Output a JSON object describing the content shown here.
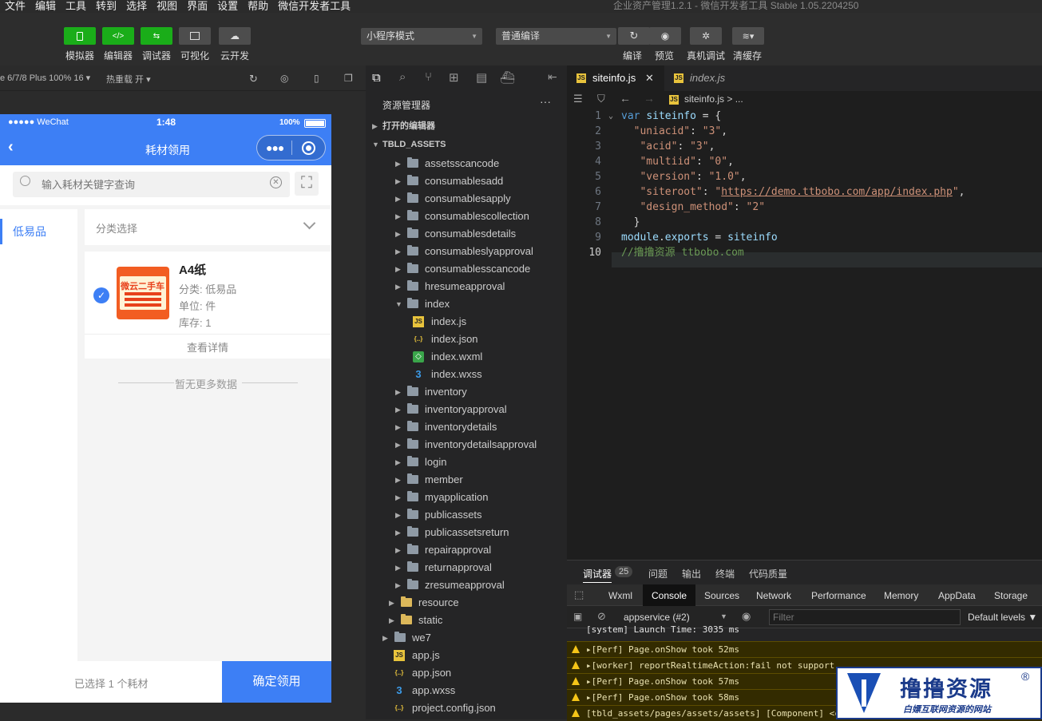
{
  "menu": [
    "文件",
    "编辑",
    "工具",
    "转到",
    "选择",
    "视图",
    "界面",
    "设置",
    "帮助",
    "微信开发者工具"
  ],
  "window_title": "企业资产管理1.2.1 - 微信开发者工具 Stable 1.05.2204250",
  "toolbar": {
    "simulator": "模拟器",
    "editor": "编辑器",
    "debugger": "调试器",
    "visual": "可视化",
    "cloud": "云开发",
    "mode": "小程序模式",
    "compile_mode": "普通编译",
    "compile": "编译",
    "preview": "预览",
    "real_debug": "真机调试",
    "clear_cache": "清缓存"
  },
  "simbar": {
    "device": "e 6/7/8 Plus 100% 16 ▾",
    "hot_reload": "热重载 开 ▾"
  },
  "phone": {
    "carrier": "●●●●● WeChat",
    "time": "1:48",
    "battery": "100%",
    "nav_title": "耗材领用",
    "search_placeholder": "输入耗材关键字查询",
    "left_category": "低易品",
    "category_select": "分类选择",
    "item": {
      "name": "A4纸",
      "category": "分类:  低易品",
      "unit": "单位:  件",
      "stock": "库存:  1",
      "detail": "查看详情",
      "thumb_text": "微云二手车"
    },
    "no_more": "暂无更多数据",
    "selected_text": "已选择 1 个耗材",
    "confirm": "确定领用"
  },
  "explorer": {
    "title": "资源管理器",
    "open_editors": "打开的编辑器",
    "root": "TBLD_ASSETS",
    "items": [
      {
        "label": "assetsscancode",
        "kind": "folder",
        "depth": 2
      },
      {
        "label": "consumablesadd",
        "kind": "folder",
        "depth": 2
      },
      {
        "label": "consumablesapply",
        "kind": "folder",
        "depth": 2
      },
      {
        "label": "consumablescollection",
        "kind": "folder",
        "depth": 2
      },
      {
        "label": "consumablesdetails",
        "kind": "folder",
        "depth": 2
      },
      {
        "label": "consumableslyapproval",
        "kind": "folder",
        "depth": 2
      },
      {
        "label": "consumablesscancode",
        "kind": "folder",
        "depth": 2
      },
      {
        "label": "hresumeapproval",
        "kind": "folder",
        "depth": 2
      },
      {
        "label": "index",
        "kind": "folder-open",
        "depth": 2
      },
      {
        "label": "index.js",
        "kind": "js",
        "depth": 3
      },
      {
        "label": "index.json",
        "kind": "json",
        "depth": 3
      },
      {
        "label": "index.wxml",
        "kind": "wxml",
        "depth": 3
      },
      {
        "label": "index.wxss",
        "kind": "wxss",
        "depth": 3
      },
      {
        "label": "inventory",
        "kind": "folder",
        "depth": 2
      },
      {
        "label": "inventoryapproval",
        "kind": "folder",
        "depth": 2
      },
      {
        "label": "inventorydetails",
        "kind": "folder",
        "depth": 2
      },
      {
        "label": "inventorydetailsapproval",
        "kind": "folder",
        "depth": 2
      },
      {
        "label": "login",
        "kind": "folder",
        "depth": 2
      },
      {
        "label": "member",
        "kind": "folder",
        "depth": 2
      },
      {
        "label": "myapplication",
        "kind": "folder",
        "depth": 2
      },
      {
        "label": "publicassets",
        "kind": "folder",
        "depth": 2
      },
      {
        "label": "publicassetsreturn",
        "kind": "folder",
        "depth": 2
      },
      {
        "label": "repairapproval",
        "kind": "folder",
        "depth": 2
      },
      {
        "label": "returnapproval",
        "kind": "folder",
        "depth": 2
      },
      {
        "label": "zresumeapproval",
        "kind": "folder",
        "depth": 2
      },
      {
        "label": "resource",
        "kind": "folder-y",
        "depth": 1
      },
      {
        "label": "static",
        "kind": "folder-y",
        "depth": 1
      },
      {
        "label": "we7",
        "kind": "folder",
        "depth": 0
      },
      {
        "label": "app.js",
        "kind": "js",
        "depth": 0
      },
      {
        "label": "app.json",
        "kind": "json",
        "depth": 0
      },
      {
        "label": "app.wxss",
        "kind": "wxss",
        "depth": 0
      },
      {
        "label": "project.config.json",
        "kind": "json",
        "depth": 0
      }
    ]
  },
  "editor": {
    "tabs": [
      "siteinfo.js",
      "index.js"
    ],
    "breadcrumb": "siteinfo.js > ...",
    "line_numbers": [
      "1",
      "2",
      "3",
      "4",
      "5",
      "6",
      "7",
      "8",
      "9",
      "10"
    ]
  },
  "devtools": {
    "tabs": [
      "调试器",
      "25",
      "问题",
      "输出",
      "终端",
      "代码质量"
    ],
    "subtabs": [
      "Wxml",
      "Console",
      "Sources",
      "Network",
      "Performance",
      "Memory",
      "AppData",
      "Storage"
    ],
    "context": "appservice (#2)",
    "filter_placeholder": "Filter",
    "levels": "Default levels ▼",
    "logs": [
      {
        "text": "[system] Launch Time: 3035 ms",
        "warn": false
      },
      {
        "text": "▸[Perf] Page.onShow took 52ms",
        "warn": true
      },
      {
        "text": "▸[worker] reportRealtimeAction:fail not support",
        "warn": true
      },
      {
        "text": "▸[Perf] Page.onShow took 57ms",
        "warn": true
      },
      {
        "text": "▸[Perf] Page.onShow took 58ms",
        "warn": true
      },
      {
        "text": "[tbld_assets/pages/assets/assets] [Component] <c",
        "warn": true
      }
    ]
  },
  "watermark": {
    "title": "撸撸资源",
    "subtitle": "白嫖互联网资源的网站",
    "reg": "®"
  },
  "colors": {
    "accent": "#3d7ff5",
    "green": "#1aad19"
  }
}
